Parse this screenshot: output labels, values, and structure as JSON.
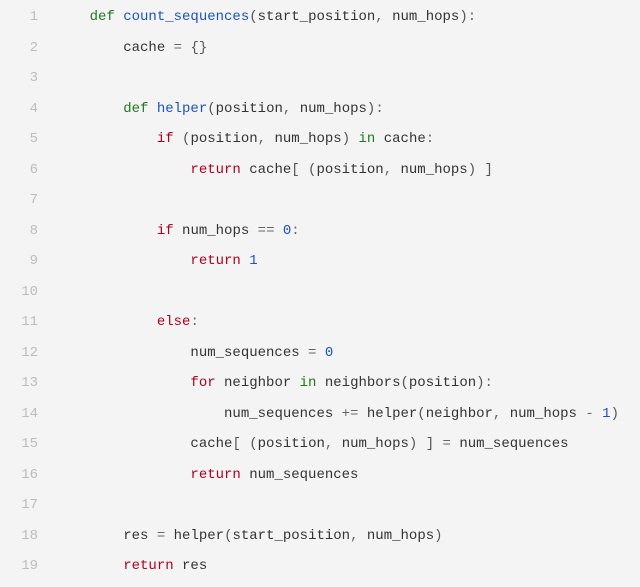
{
  "code": {
    "lines": [
      {
        "n": "1",
        "indent": 1,
        "tokens": [
          [
            "kw",
            "def "
          ],
          [
            "def",
            "count_sequences"
          ],
          [
            "br",
            "("
          ],
          [
            "id",
            "start_position"
          ],
          [
            "op",
            ", "
          ],
          [
            "id",
            "num_hops"
          ],
          [
            "br",
            ")"
          ],
          [
            "op",
            ":"
          ]
        ]
      },
      {
        "n": "2",
        "indent": 2,
        "tokens": [
          [
            "id",
            "cache "
          ],
          [
            "op",
            "= "
          ],
          [
            "br",
            "{}"
          ]
        ]
      },
      {
        "n": "3",
        "indent": 0,
        "tokens": []
      },
      {
        "n": "4",
        "indent": 2,
        "tokens": [
          [
            "kw",
            "def "
          ],
          [
            "def",
            "helper"
          ],
          [
            "br",
            "("
          ],
          [
            "id",
            "position"
          ],
          [
            "op",
            ", "
          ],
          [
            "id",
            "num_hops"
          ],
          [
            "br",
            ")"
          ],
          [
            "op",
            ":"
          ]
        ]
      },
      {
        "n": "5",
        "indent": 3,
        "tokens": [
          [
            "kw2",
            "if "
          ],
          [
            "br",
            "("
          ],
          [
            "id",
            "position"
          ],
          [
            "op",
            ", "
          ],
          [
            "id",
            "num_hops"
          ],
          [
            "br",
            ") "
          ],
          [
            "kw",
            "in "
          ],
          [
            "id",
            "cache"
          ],
          [
            "op",
            ":"
          ]
        ]
      },
      {
        "n": "6",
        "indent": 4,
        "tokens": [
          [
            "kw2",
            "return "
          ],
          [
            "id",
            "cache"
          ],
          [
            "br",
            "[ ("
          ],
          [
            "id",
            "position"
          ],
          [
            "op",
            ", "
          ],
          [
            "id",
            "num_hops"
          ],
          [
            "br",
            ") ]"
          ]
        ]
      },
      {
        "n": "7",
        "indent": 0,
        "tokens": []
      },
      {
        "n": "8",
        "indent": 3,
        "tokens": [
          [
            "kw2",
            "if "
          ],
          [
            "id",
            "num_hops "
          ],
          [
            "op",
            "== "
          ],
          [
            "num",
            "0"
          ],
          [
            "op",
            ":"
          ]
        ]
      },
      {
        "n": "9",
        "indent": 4,
        "tokens": [
          [
            "kw2",
            "return "
          ],
          [
            "num",
            "1"
          ]
        ]
      },
      {
        "n": "10",
        "indent": 0,
        "tokens": []
      },
      {
        "n": "11",
        "indent": 3,
        "tokens": [
          [
            "kw2",
            "else"
          ],
          [
            "op",
            ":"
          ]
        ]
      },
      {
        "n": "12",
        "indent": 4,
        "tokens": [
          [
            "id",
            "num_sequences "
          ],
          [
            "op",
            "= "
          ],
          [
            "num",
            "0"
          ]
        ]
      },
      {
        "n": "13",
        "indent": 4,
        "tokens": [
          [
            "kw2",
            "for "
          ],
          [
            "id",
            "neighbor "
          ],
          [
            "kw",
            "in "
          ],
          [
            "id",
            "neighbors"
          ],
          [
            "br",
            "("
          ],
          [
            "id",
            "position"
          ],
          [
            "br",
            ")"
          ],
          [
            "op",
            ":"
          ]
        ]
      },
      {
        "n": "14",
        "indent": 5,
        "tokens": [
          [
            "id",
            "num_sequences "
          ],
          [
            "op",
            "+= "
          ],
          [
            "id",
            "helper"
          ],
          [
            "br",
            "("
          ],
          [
            "id",
            "neighbor"
          ],
          [
            "op",
            ", "
          ],
          [
            "id",
            "num_hops "
          ],
          [
            "op",
            "- "
          ],
          [
            "num",
            "1"
          ],
          [
            "br",
            ")"
          ]
        ]
      },
      {
        "n": "15",
        "indent": 4,
        "tokens": [
          [
            "id",
            "cache"
          ],
          [
            "br",
            "[ ("
          ],
          [
            "id",
            "position"
          ],
          [
            "op",
            ", "
          ],
          [
            "id",
            "num_hops"
          ],
          [
            "br",
            ") ] "
          ],
          [
            "op",
            "= "
          ],
          [
            "id",
            "num_sequences"
          ]
        ]
      },
      {
        "n": "16",
        "indent": 4,
        "tokens": [
          [
            "kw2",
            "return "
          ],
          [
            "id",
            "num_sequences"
          ]
        ]
      },
      {
        "n": "17",
        "indent": 0,
        "tokens": []
      },
      {
        "n": "18",
        "indent": 2,
        "tokens": [
          [
            "id",
            "res "
          ],
          [
            "op",
            "= "
          ],
          [
            "id",
            "helper"
          ],
          [
            "br",
            "("
          ],
          [
            "id",
            "start_position"
          ],
          [
            "op",
            ", "
          ],
          [
            "id",
            "num_hops"
          ],
          [
            "br",
            ")"
          ]
        ]
      },
      {
        "n": "19",
        "indent": 2,
        "tokens": [
          [
            "kw2",
            "return "
          ],
          [
            "id",
            "res"
          ]
        ]
      }
    ],
    "indent_unit": "    "
  }
}
